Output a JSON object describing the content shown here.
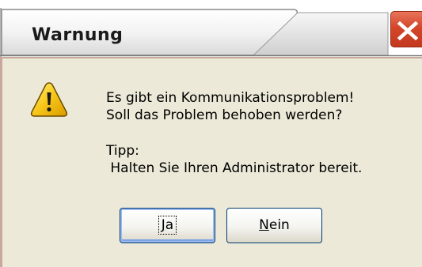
{
  "window": {
    "title": "Warnung",
    "close_icon": "close-x-icon"
  },
  "message": {
    "icon": "warning-icon",
    "line1": "Es gibt ein Kommunikationsproblem!",
    "line2": "Soll das Problem behoben werden?",
    "tip_label": "Tipp:",
    "tip_text": " Halten Sie Ihren Administrator bereit."
  },
  "buttons": {
    "yes": {
      "mnemonic": "J",
      "rest": "a"
    },
    "no": {
      "mnemonic": "N",
      "rest": "ein"
    }
  },
  "colors": {
    "dialog_bg": "#ece9d8",
    "close_button": "#d4462a",
    "warning_yellow": "#f7c718",
    "focus_border": "#7ea2e6"
  }
}
